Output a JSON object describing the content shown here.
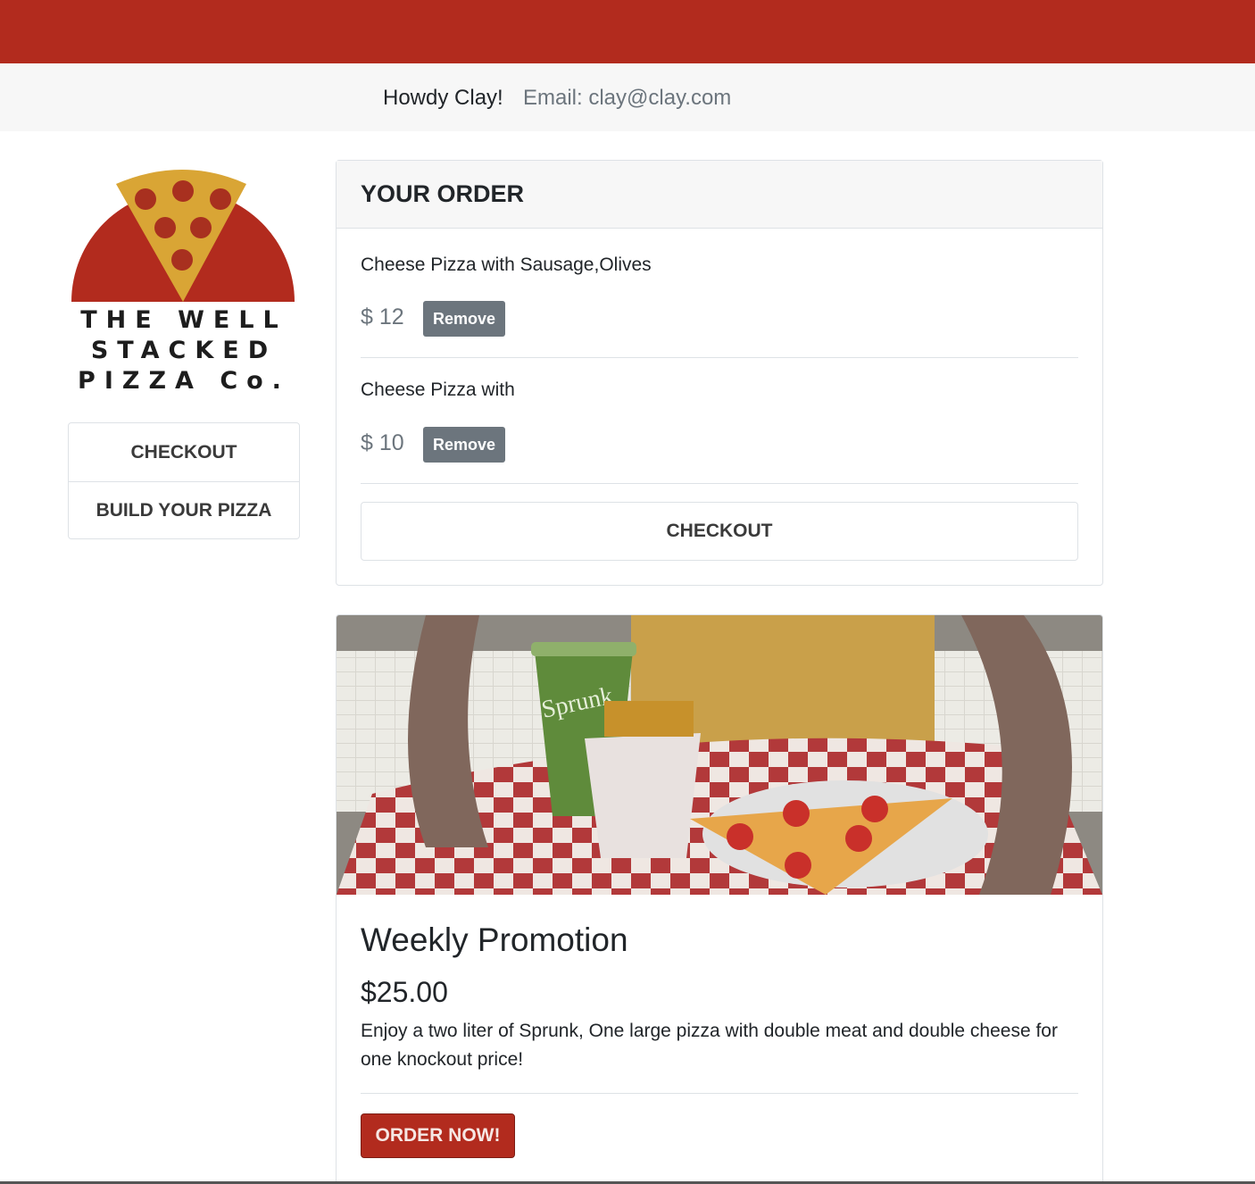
{
  "header": {
    "greeting": "Howdy Clay!",
    "email": "Email: clay@clay.com"
  },
  "logo": {
    "lines": [
      "THE WELL",
      "STACKED",
      "PIZZA Co."
    ]
  },
  "sidebar": {
    "items": [
      {
        "label": "CHECKOUT"
      },
      {
        "label": "BUILD YOUR PIZZA"
      }
    ]
  },
  "order": {
    "title": "YOUR ORDER",
    "items": [
      {
        "name": "Cheese Pizza with Sausage,Olives",
        "price": "$ 12",
        "remove_label": "Remove"
      },
      {
        "name": "Cheese Pizza with",
        "price": "$ 10",
        "remove_label": "Remove"
      }
    ],
    "checkout_label": "CHECKOUT"
  },
  "promotion": {
    "image_text": "Sprunk",
    "title": "Weekly Promotion",
    "price": "$25.00",
    "description": "Enjoy a two liter of Sprunk, One large pizza with double meat and double cheese for one knockout price!",
    "button_label": "ORDER NOW!"
  },
  "colors": {
    "brand_red": "#b22b1e",
    "secondary": "#6c757d",
    "pizza_crust": "#d9a535"
  }
}
